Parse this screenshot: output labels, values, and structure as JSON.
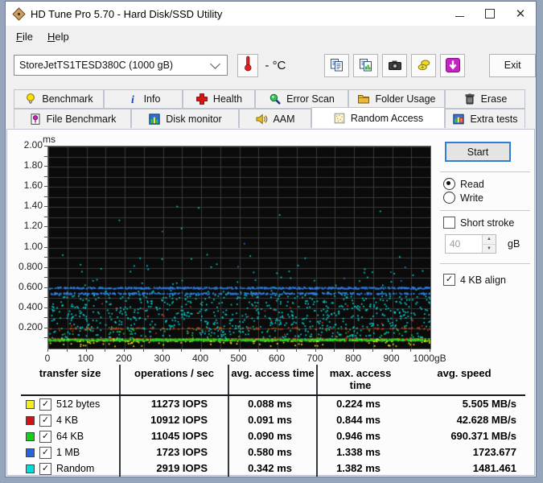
{
  "window": {
    "title": "HD Tune Pro 5.70 - Hard Disk/SSD Utility",
    "controls": [
      "minimize",
      "maximize",
      "close"
    ]
  },
  "menu": {
    "items": [
      "File",
      "Help"
    ]
  },
  "toolbar": {
    "drive_select": "StoreJetTS1TESD380C (1000 gB)",
    "temp_value": "-",
    "temp_unit": "°C",
    "buttons": [
      "copy-text-icon",
      "copy-image-icon",
      "camera-icon",
      "save-results-icon",
      "update-icon"
    ],
    "exit_label": "Exit"
  },
  "tabs": {
    "active": "Random Access",
    "row1": [
      {
        "label": "Benchmark",
        "icon": "lightbulb-icon"
      },
      {
        "label": "Info",
        "icon": "info-icon"
      },
      {
        "label": "Health",
        "icon": "health-cross-icon"
      },
      {
        "label": "Error Scan",
        "icon": "error-scan-magnifier-icon"
      },
      {
        "label": "Folder Usage",
        "icon": "folder-usage-icon"
      },
      {
        "label": "Erase",
        "icon": "erase-trash-icon"
      }
    ],
    "row2": [
      {
        "label": "File Benchmark",
        "icon": "file-benchmark-icon"
      },
      {
        "label": "Disk monitor",
        "icon": "disk-monitor-icon"
      },
      {
        "label": "AAM",
        "icon": "aam-speaker-icon"
      },
      {
        "label": "Random Access",
        "icon": "random-access-icon"
      },
      {
        "label": "Extra tests",
        "icon": "extra-tests-icon"
      }
    ]
  },
  "panel": {
    "start_label": "Start",
    "read_label": "Read",
    "write_label": "Write",
    "read_selected": true,
    "write_selected": false,
    "short_stroke_label": "Short stroke",
    "short_stroke_checked": false,
    "stroke_value": "40",
    "stroke_unit": "gB",
    "align_label": "4 KB align",
    "align_checked": true
  },
  "chart_data": {
    "type": "scatter",
    "title": "Random access time vs disk position",
    "y_unit": "ms",
    "ylim": [
      0,
      2.0
    ],
    "xlim": [
      0,
      1000
    ],
    "grid": {
      "x_step": 50,
      "y_step": 0.1,
      "color": "#3a3a3a"
    },
    "background": "#0b0b0b",
    "y_tick_labels": [
      "2.00",
      "1.80",
      "1.60",
      "1.40",
      "1.20",
      "1.00",
      "0.800",
      "0.600",
      "0.400",
      "0.200"
    ],
    "x_tick_labels": [
      "0",
      "100",
      "200",
      "300",
      "400",
      "500",
      "600",
      "700",
      "800",
      "900",
      "1000gB"
    ],
    "series": [
      {
        "name": "Random",
        "color": "#00d8d8",
        "avg_ms": 0.342,
        "max_ms": 1.382,
        "clusters": [
          {
            "y_min": 0.1,
            "y_max": 0.57,
            "count": 820
          },
          {
            "y_min": 0.57,
            "y_max": 0.95,
            "count": 55
          },
          {
            "y_min": 0.95,
            "y_max": 1.45,
            "count": 6
          }
        ]
      },
      {
        "name": "4 KB",
        "color": "#de2a18",
        "avg_ms": 0.091,
        "max_ms": 0.844,
        "clusters": [
          {
            "y_min": 0.082,
            "y_max": 0.106,
            "count": 250
          },
          {
            "y_min": 0.198,
            "y_max": 0.212,
            "count": 130,
            "color": "#bb5410"
          },
          {
            "y_min": 0.11,
            "y_max": 0.45,
            "count": 35
          }
        ]
      },
      {
        "name": "512 bytes",
        "color": "#f0ee20",
        "avg_ms": 0.088,
        "max_ms": 0.224,
        "clusters": [
          {
            "y_min": 0.076,
            "y_max": 0.1,
            "count": 300
          },
          {
            "y_min": 0.028,
            "y_max": 0.07,
            "count": 55
          }
        ]
      },
      {
        "name": "64 KB",
        "color": "#1ad31a",
        "avg_ms": 0.09,
        "max_ms": 0.946,
        "clusters": [
          {
            "y_min": 0.082,
            "y_max": 0.1,
            "count": 750
          },
          {
            "y_min": 0.1,
            "y_max": 0.21,
            "count": 35
          }
        ]
      },
      {
        "name": "1 MB",
        "color": "#2e7fe8",
        "avg_ms": 0.58,
        "max_ms": 1.338,
        "clusters": [
          {
            "y_min": 0.597,
            "y_max": 0.613,
            "count": 520
          },
          {
            "y_min": 0.542,
            "y_max": 0.558,
            "count": 400
          },
          {
            "y_min": 0.63,
            "y_max": 1.3,
            "count": 7
          }
        ]
      }
    ]
  },
  "table": {
    "headers": [
      "transfer size",
      "operations / sec",
      "avg. access time",
      "max. access time",
      "avg. speed"
    ],
    "rows": [
      {
        "color": "#f0ee20",
        "checked": true,
        "label": "512 bytes",
        "ops": "11273 IOPS",
        "avg": "0.088 ms",
        "max": "0.224 ms",
        "speed": "5.505 MB/s"
      },
      {
        "color": "#d01414",
        "checked": true,
        "label": "4 KB",
        "ops": "10912 IOPS",
        "avg": "0.091 ms",
        "max": "0.844 ms",
        "speed": "42.628 MB/s"
      },
      {
        "color": "#17cf17",
        "checked": true,
        "label": "64 KB",
        "ops": "11045 IOPS",
        "avg": "0.090 ms",
        "max": "0.946 ms",
        "speed": "690.371 MB/s"
      },
      {
        "color": "#2b62d9",
        "checked": true,
        "label": "1 MB",
        "ops": "1723 IOPS",
        "avg": "0.580 ms",
        "max": "1.338 ms",
        "speed": "1723.677"
      },
      {
        "color": "#00dcdc",
        "checked": true,
        "label": "Random",
        "ops": "2919 IOPS",
        "avg": "0.342 ms",
        "max": "1.382 ms",
        "speed": "1481.461"
      }
    ]
  }
}
